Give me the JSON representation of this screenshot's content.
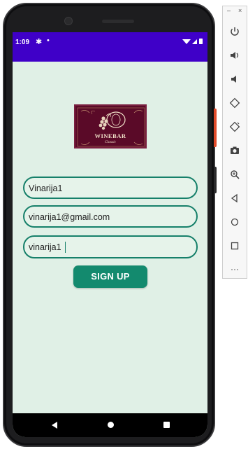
{
  "status_bar": {
    "time": "1:09",
    "settings_icon": "gear-icon",
    "notification_dot": "•",
    "wifi_icon": "wifi-icon",
    "signal_icon": "signal-icon",
    "battery_icon": "battery-icon",
    "color": "#3f00c8"
  },
  "logo": {
    "title": "WINEBAR",
    "subtitle": "Classic"
  },
  "form": {
    "username_value": "Vinarija1",
    "email_value": "vinarija1@gmail.com",
    "password_value": "vinarija1",
    "submit_label": "SIGN UP",
    "accent_color": "#138a6e",
    "background_color": "#e0f0e6"
  },
  "nav_bar": {
    "back_icon": "back-triangle-icon",
    "home_icon": "home-circle-icon",
    "recent_icon": "recent-square-icon"
  },
  "emulator_toolbar": {
    "minimize_label": "–",
    "close_label": "×",
    "buttons": [
      "power-icon",
      "volume-up-icon",
      "volume-down-icon",
      "rotate-left-icon",
      "rotate-right-icon",
      "camera-icon",
      "zoom-icon",
      "back-icon",
      "home-icon",
      "overview-icon"
    ],
    "more_label": "···"
  }
}
